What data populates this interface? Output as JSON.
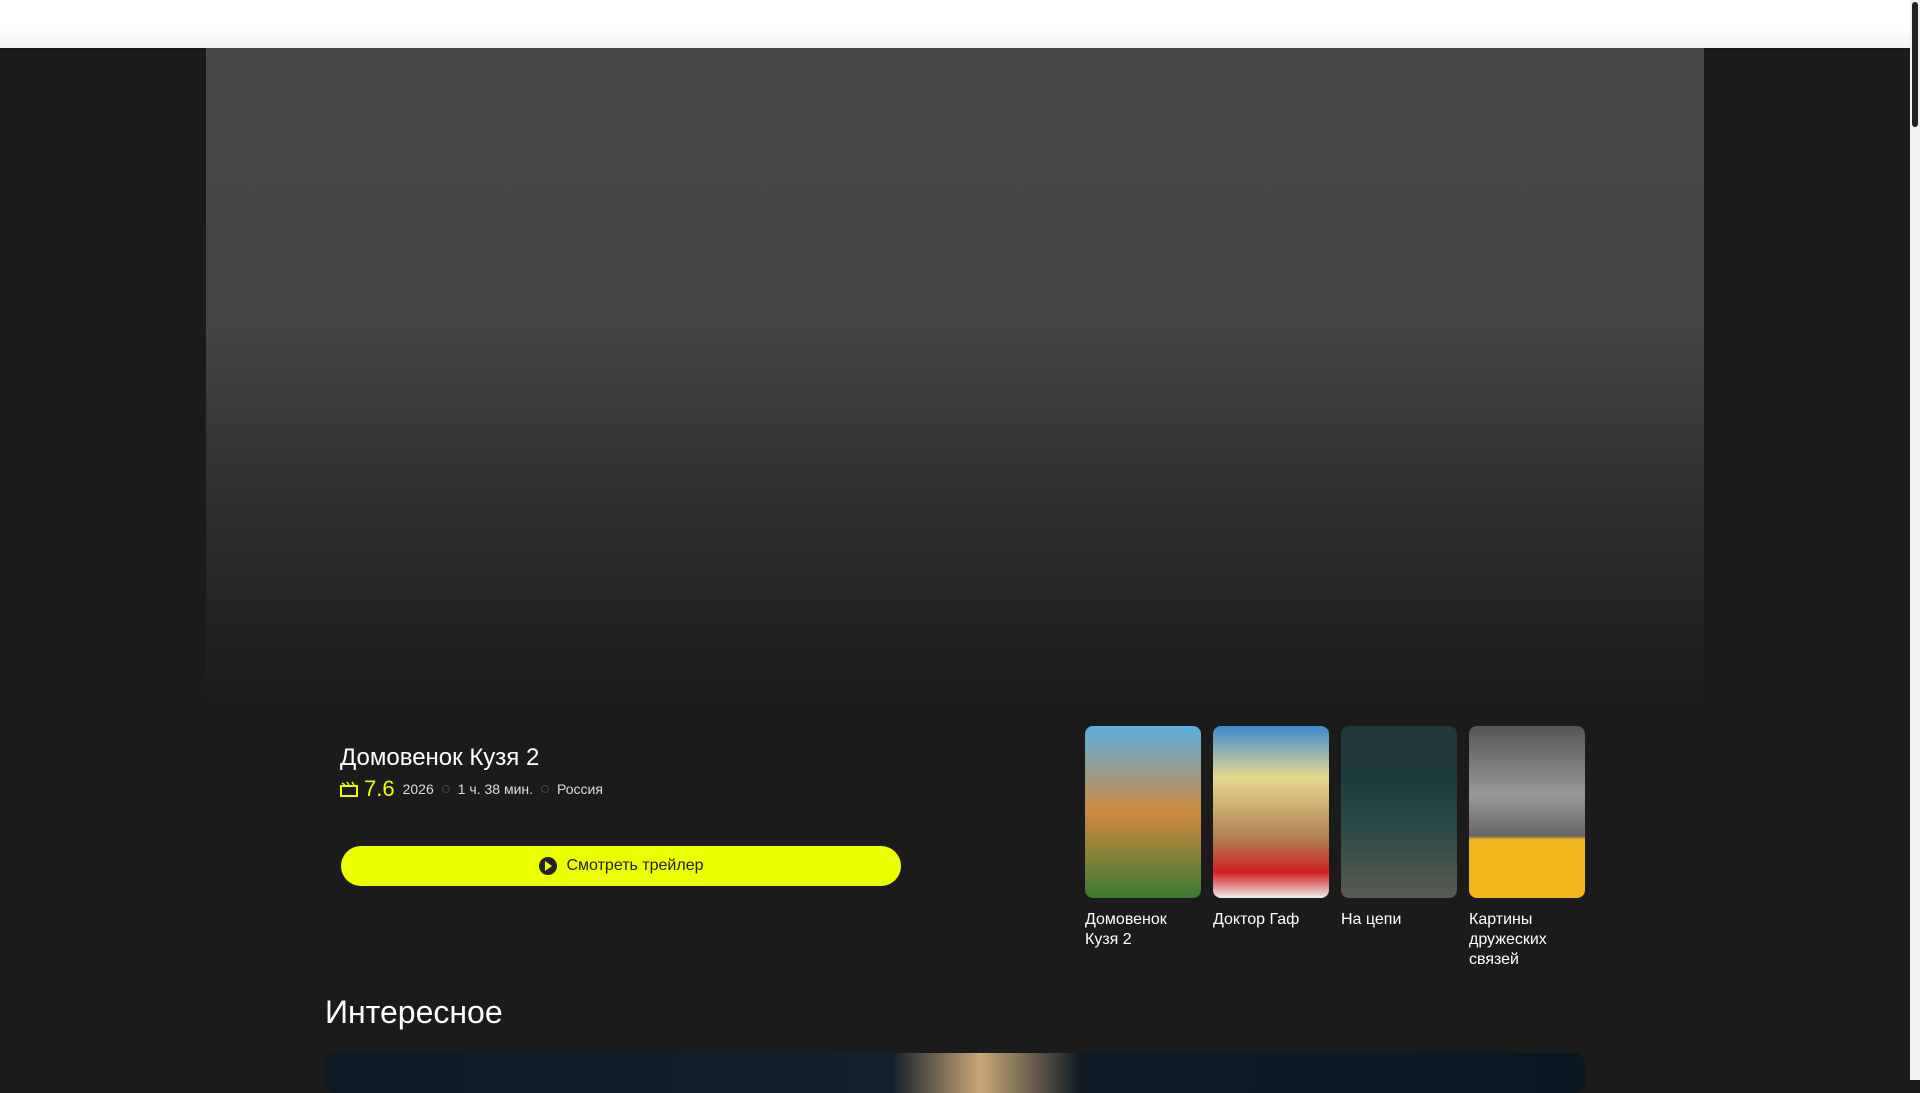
{
  "hero": {
    "title": "Домовенок Кузя 2",
    "rating": "7.6",
    "year": "2026",
    "duration": "1 ч. 38 мин.",
    "country": "Россия",
    "trailer_label": "Смотреть трейлер"
  },
  "posters": [
    {
      "title": "Домовенок Кузя 2",
      "color": "#3a8fc0"
    },
    {
      "title": "Доктор Гаф",
      "color": "#c9a050"
    },
    {
      "title": "На цепи",
      "color": "#1f3a3c"
    },
    {
      "title": "Картины дружеских связей",
      "color": "#f2b71d"
    }
  ],
  "section": {
    "title": "Интересное"
  },
  "colors": {
    "accent": "#ebff00",
    "background": "#1b1b1b"
  }
}
